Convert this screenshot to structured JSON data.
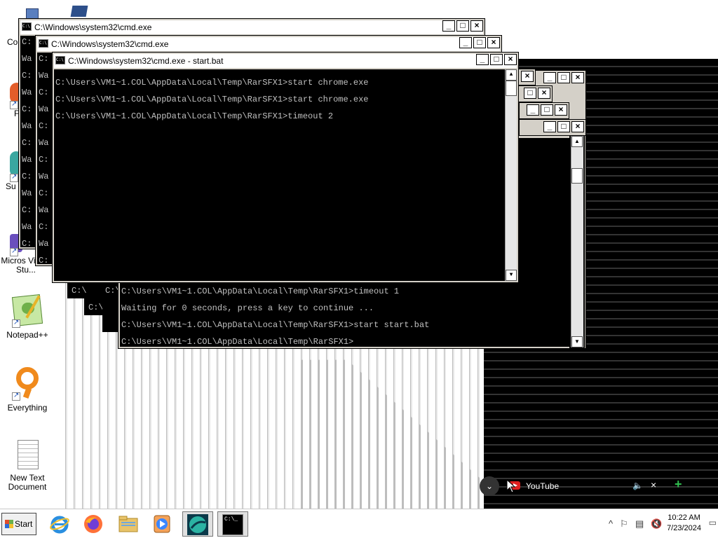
{
  "desktop_icons": [
    {
      "id": "computer",
      "label": "Co"
    },
    {
      "id": "f-app",
      "label": "F"
    },
    {
      "id": "support",
      "label": "Su"
    },
    {
      "id": "vs",
      "label": "Micros Visual Stu..."
    },
    {
      "id": "notepadpp",
      "label": "Notepad++"
    },
    {
      "id": "everything",
      "label": "Everything"
    },
    {
      "id": "newtext",
      "label": "New Text Document"
    }
  ],
  "windows": {
    "back1": {
      "title": "C:\\Windows\\system32\\cmd.exe",
      "lines": [
        "C:",
        "Wa",
        "C:",
        "Wa",
        "C:",
        "Wa",
        "C:",
        "Wa",
        "C:",
        "Wa",
        "C:",
        "Wa",
        "C:"
      ]
    },
    "back2": {
      "title": "C:\\Windows\\system32\\cmd.exe",
      "lines": [
        "C:",
        "Wa",
        "C:",
        "Wa",
        "C:",
        "Wa",
        "C:",
        "Wa",
        "C:",
        "Wa",
        "C:",
        "Wa",
        "C:"
      ]
    },
    "front": {
      "title": "C:\\Windows\\system32\\cmd.exe - start.bat",
      "lines": [
        "C:\\Users\\VM1~1.COL\\AppData\\Local\\Temp\\RarSFX1>start chrome.exe",
        "C:\\Users\\VM1~1.COL\\AppData\\Local\\Temp\\RarSFX1>start chrome.exe",
        "C:\\Users\\VM1~1.COL\\AppData\\Local\\Temp\\RarSFX1>timeout 2"
      ]
    },
    "lower": {
      "lines": [
        "C:\\Users\\VM1~1.COL\\AppData\\Local\\Temp\\RarSFX1>timeout 1",
        "Waiting for 0 seconds, press a key to continue ...",
        "C:\\Users\\VM1~1.COL\\AppData\\Local\\Temp\\RarSFX1>start start.bat",
        "C:\\Users\\VM1~1.COL\\AppData\\Local\\Temp\\RarSFX1>"
      ],
      "stub1": "C:\\",
      "stub2": "C:\\",
      "stub3": "C:\\Wa"
    }
  },
  "title_buttons": {
    "minimize": "_",
    "maximize": "□",
    "close": "×"
  },
  "youtube_bar": {
    "label": "YouTube",
    "chevron": "⌄",
    "volume": "🔈",
    "close": "×",
    "plus": "+"
  },
  "taskbar": {
    "start_label": "Start",
    "apps": [
      {
        "id": "ie",
        "name": "ie-icon"
      },
      {
        "id": "firefox",
        "name": "firefox-icon"
      },
      {
        "id": "explorer",
        "name": "folder-icon"
      },
      {
        "id": "media",
        "name": "media-player-icon"
      },
      {
        "id": "app5",
        "name": "globe-app-icon"
      },
      {
        "id": "cmd",
        "name": "cmd-icon",
        "text": "C:\\_"
      }
    ],
    "tray": {
      "chevron": "^",
      "flag": "⚐",
      "network": "▤",
      "volume": "🔇"
    },
    "clock_time": "10:22 AM",
    "clock_date": "7/23/2024"
  }
}
